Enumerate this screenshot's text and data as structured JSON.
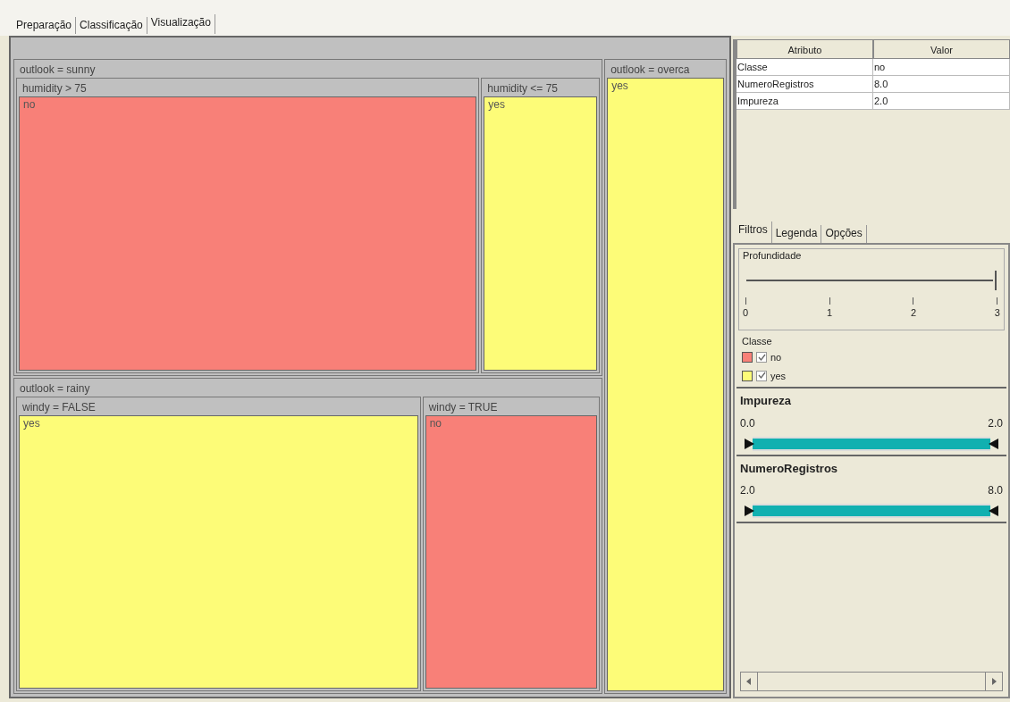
{
  "tabs": [
    {
      "label": "Preparação",
      "selected": false
    },
    {
      "label": "Classificação",
      "selected": false
    },
    {
      "label": "Visualização",
      "selected": true
    }
  ],
  "treemap": {
    "children": [
      {
        "label": "outlook = sunny",
        "children": [
          {
            "label": "humidity > 75",
            "leaf": "no",
            "color": "#f88078"
          },
          {
            "label": "humidity <= 75",
            "leaf": "yes",
            "color": "#fdfc78"
          }
        ]
      },
      {
        "label": "outlook = rainy",
        "children": [
          {
            "label": "windy = FALSE",
            "leaf": "yes",
            "color": "#fdfc78"
          },
          {
            "label": "windy = TRUE",
            "leaf": "no",
            "color": "#f88078"
          }
        ]
      },
      {
        "label": "outlook = overca",
        "leaf": "yes",
        "color": "#fdfc78"
      }
    ]
  },
  "attributes": {
    "columns": [
      "Atributo",
      "Valor"
    ],
    "rows": [
      [
        "Classe",
        "no"
      ],
      [
        "NumeroRegistros",
        "8.0"
      ],
      [
        "Impureza",
        "2.0"
      ]
    ]
  },
  "panel_tabs": [
    {
      "label": "Filtros",
      "selected": true
    },
    {
      "label": "Legenda",
      "selected": false
    },
    {
      "label": "Opções",
      "selected": false
    }
  ],
  "depth": {
    "title": "Profundidade",
    "ticks": [
      "0",
      "1",
      "2",
      "3"
    ],
    "level": 1
  },
  "classes": {
    "title": "Classe",
    "items": [
      {
        "label": "no",
        "color": "#f88078",
        "checked": true
      },
      {
        "label": "yes",
        "color": "#fdfc78",
        "checked": true
      }
    ]
  },
  "ranges": [
    {
      "title": "Impureza",
      "min": "0.0",
      "max": "2.0",
      "level": 1
    },
    {
      "title": "NumeroRegistros",
      "min": "2.0",
      "max": "8.0",
      "level": 1
    }
  ]
}
